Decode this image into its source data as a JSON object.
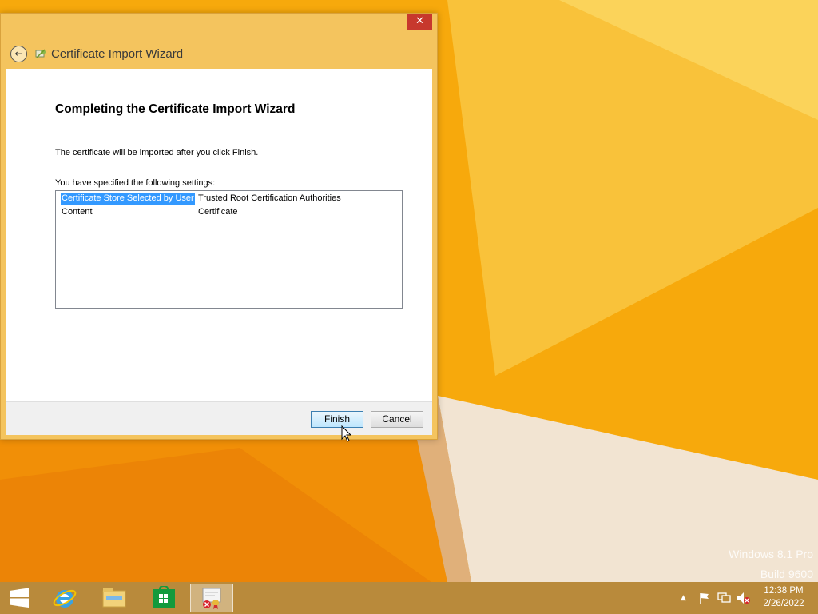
{
  "desktop": {
    "watermark_line1": "Windows 8.1 Pro",
    "watermark_line2": "Build 9600",
    "colors": {
      "primary": "#f7a90c",
      "light": "#fbd35a",
      "shadow": "#e98a08",
      "pale": "#f2e4d2"
    }
  },
  "window": {
    "title": "Certificate Import Wizard",
    "close_label": "✕",
    "back_icon": "back-arrow-icon",
    "heading": "Completing the Certificate Import Wizard",
    "description": "The certificate will be imported after you click Finish.",
    "settings_label": "You have specified the following settings:",
    "settings": [
      {
        "key": "Certificate Store Selected by User",
        "value": "Trusted Root Certification Authorities",
        "selected": true
      },
      {
        "key": "Content",
        "value": "Certificate",
        "selected": false
      }
    ],
    "buttons": {
      "finish": "Finish",
      "cancel": "Cancel"
    },
    "frame_color": "#f4c45e"
  },
  "taskbar": {
    "items": [
      "start-icon",
      "internet-explorer-icon",
      "file-explorer-icon",
      "store-icon",
      "certificate-icon"
    ],
    "clock_time": "12:38 PM",
    "clock_date": "2/26/2022",
    "tray_icons": [
      "show-hidden-icons-icon",
      "action-center-flag-icon",
      "network-icon",
      "volume-muted-icon"
    ]
  }
}
